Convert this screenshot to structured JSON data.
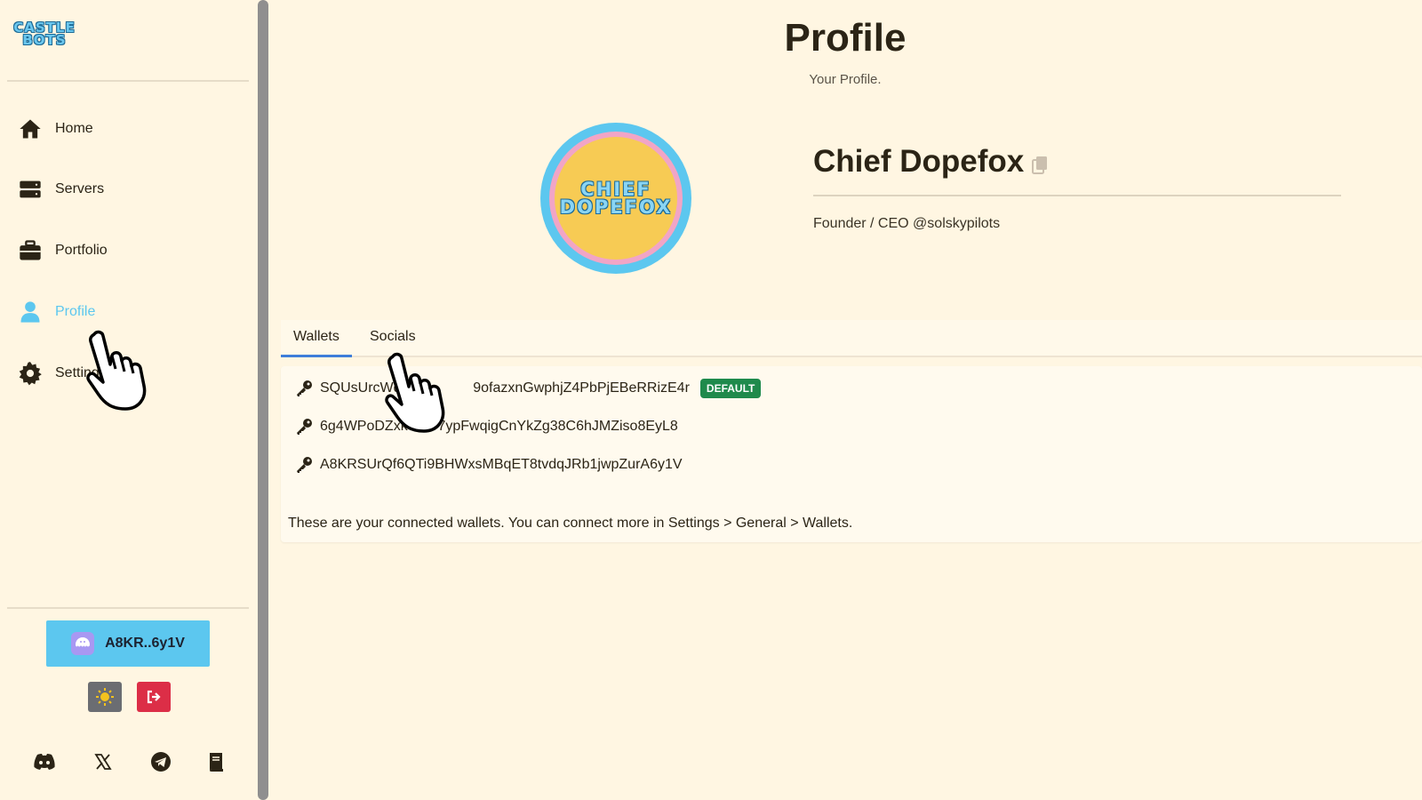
{
  "brand": {
    "logo_line1": "CASTLE",
    "logo_line2": "BOTS"
  },
  "sidebar": {
    "items": [
      {
        "label": "Home",
        "icon": "home-icon"
      },
      {
        "label": "Servers",
        "icon": "server-icon"
      },
      {
        "label": "Portfolio",
        "icon": "briefcase-icon"
      },
      {
        "label": "Profile",
        "icon": "user-icon",
        "active": true
      },
      {
        "label": "Settings",
        "icon": "gear-icon"
      }
    ],
    "wallet_button": {
      "label": "A8KR..6y1V",
      "icon": "phantom-icon"
    },
    "theme_toggle_icon": "sun-icon",
    "logout_icon": "logout-icon",
    "socials": [
      "discord-icon",
      "x-icon",
      "telegram-icon",
      "docs-icon"
    ]
  },
  "header": {
    "title": "Profile",
    "subtitle": "Your Profile."
  },
  "profile": {
    "avatar_text_line1": "CHIEF",
    "avatar_text_line2": "DOPEFOX",
    "name": "Chief Dopefox",
    "bio": "Founder / CEO @solskypilots"
  },
  "tabs": [
    {
      "label": "Wallets",
      "active": true
    },
    {
      "label": "Socials",
      "active": false
    }
  ],
  "wallets": [
    {
      "address": "SQUsUrcWdX",
      "address_rest": "9ofazxnGwphjZ4PbPjEBeRRizE4r",
      "badge": "DEFAULT"
    },
    {
      "address": "6g4WPoDZxkeNrv7ypFwqigCnYkZg38C6hJMZiso8EyL8"
    },
    {
      "address": "A8KRSUrQf6QTi9BHWxsMBqET8tvdqJRb1jwpZurA6y1V"
    }
  ],
  "wallets_note": "These are your connected wallets. You can connect more in Settings > General > Wallets.",
  "colors": {
    "background": "#fff6e2",
    "accent": "#5cc7ef",
    "tab_underline": "#3d7ed9",
    "default_badge": "#1f8a4c",
    "logout": "#dc2e47"
  }
}
